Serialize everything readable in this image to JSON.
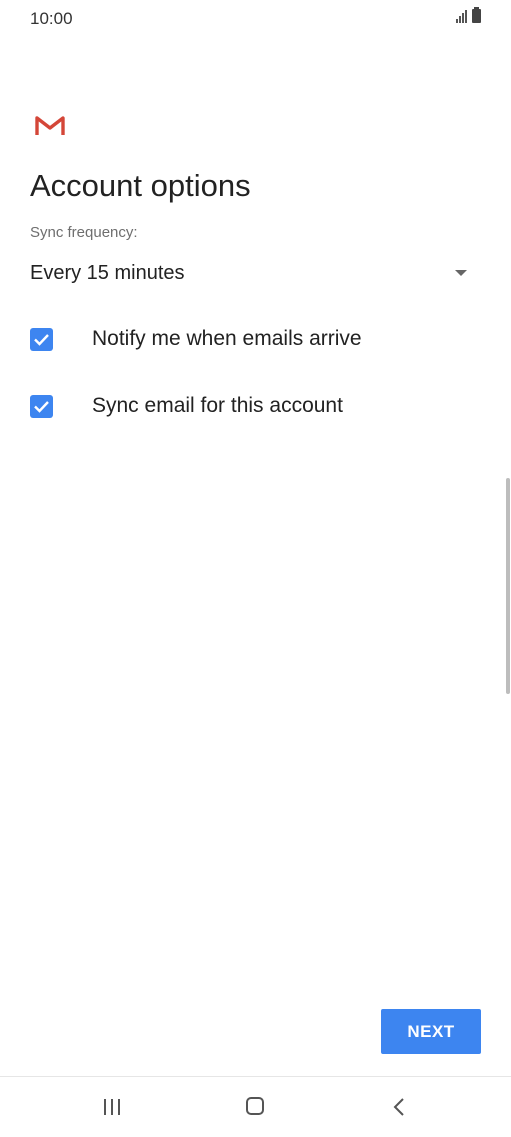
{
  "status_bar": {
    "time": "10:00"
  },
  "screen": {
    "title": "Account options",
    "sync_label": "Sync frequency:",
    "sync_value": "Every 15 minutes",
    "options": [
      {
        "label": "Notify me when emails arrive",
        "checked": true
      },
      {
        "label": "Sync email for this account",
        "checked": true
      }
    ]
  },
  "buttons": {
    "next_label": "NEXT"
  },
  "colors": {
    "accent": "#3d85f0",
    "gmail_red": "#d44638"
  },
  "icons": [
    "gmail-logo-icon",
    "signal-icon",
    "battery-icon",
    "checkbox-checked-icon",
    "dropdown-arrow-icon",
    "recents-icon",
    "home-icon",
    "back-icon"
  ]
}
